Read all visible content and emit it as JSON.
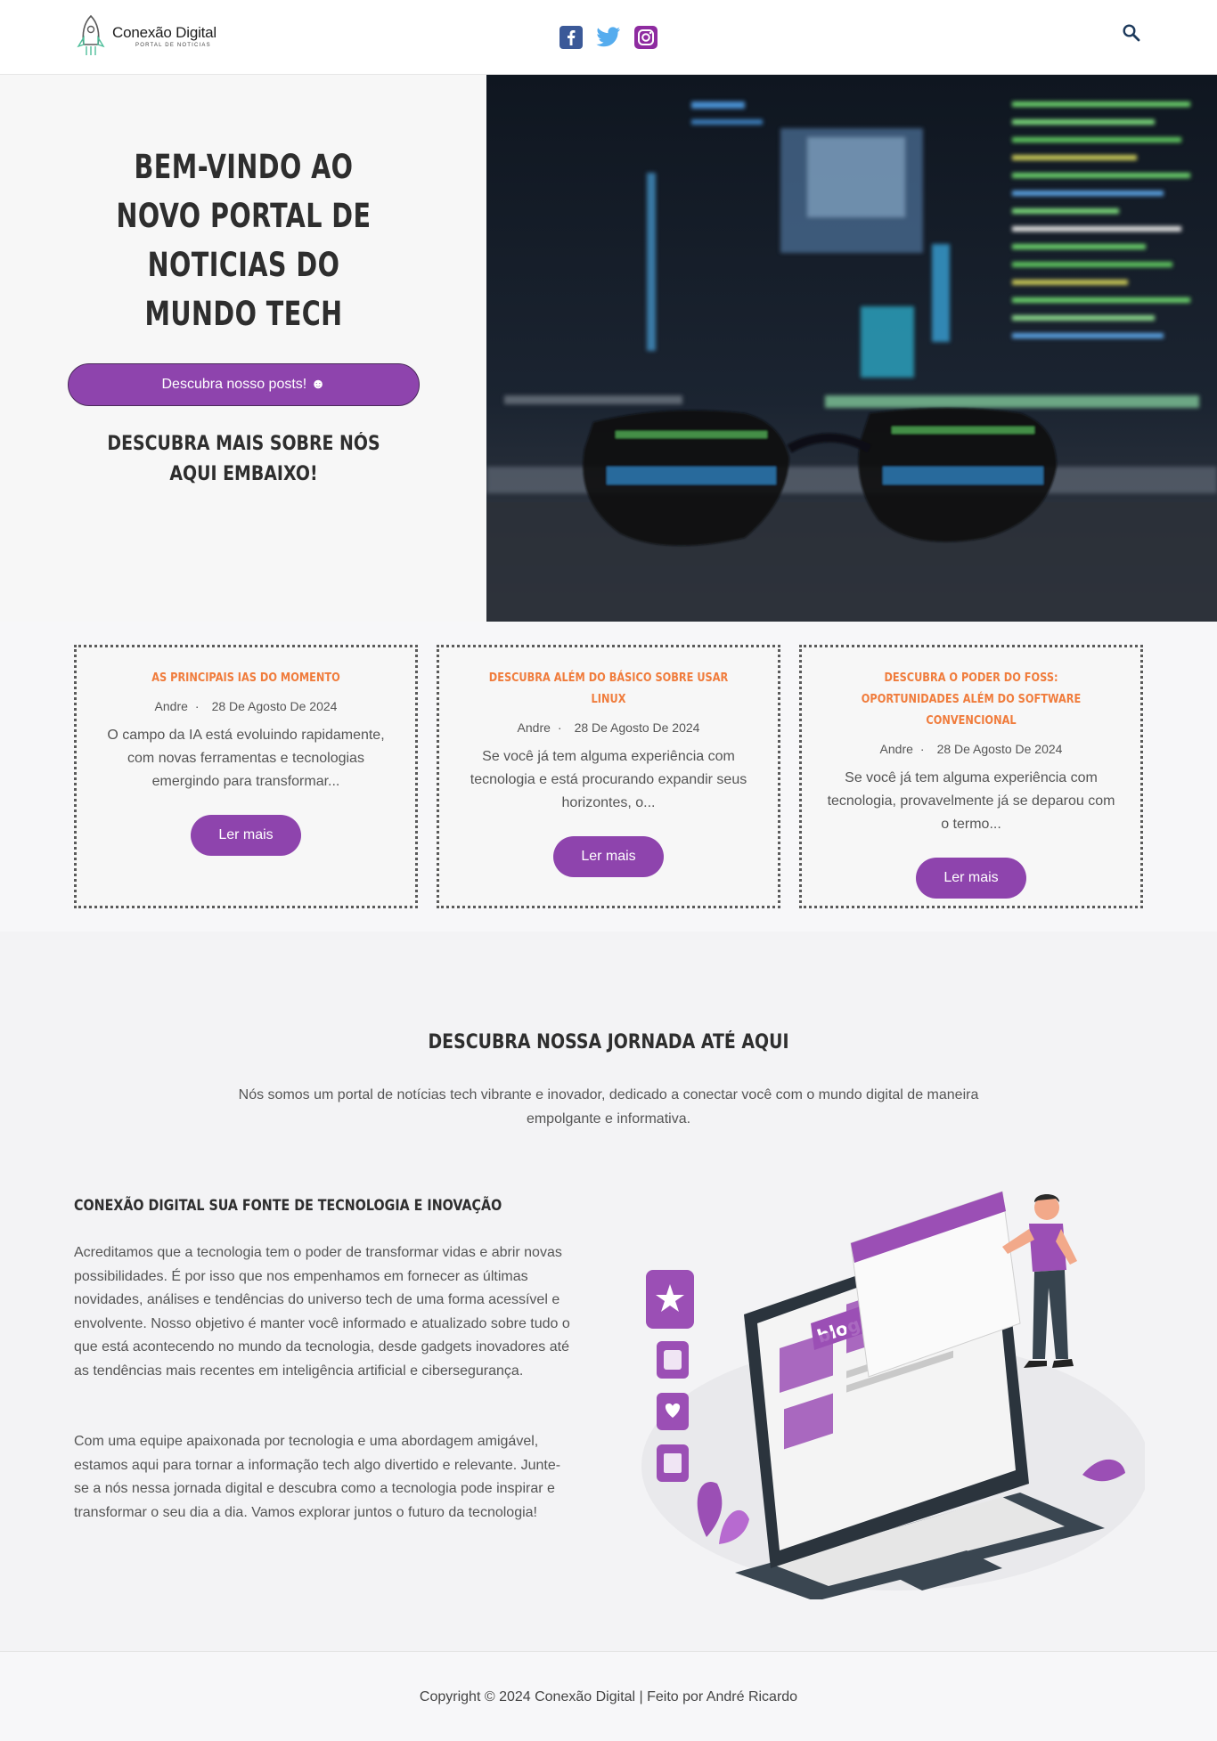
{
  "header": {
    "logo_name": "Conexão Digital",
    "logo_sub": "PORTAL DE NOTICIAS",
    "socials": [
      "facebook-icon",
      "twitter-icon",
      "instagram-icon"
    ],
    "search_icon": "search-icon"
  },
  "hero": {
    "title": "Bem-vindo ao novo portal de noticias do mundo tech",
    "button_label": "Descubra nosso posts! ☻",
    "subtitle": "Descubra mais sobre nós aqui embaixo!"
  },
  "posts": [
    {
      "title": "As principais IAs do momento",
      "author": "Andre",
      "date": "28 De Agosto De 2024",
      "excerpt": "O campo da IA está evoluindo rapidamente, com novas ferramentas e tecnologias emergindo para transformar...",
      "button": "Ler mais"
    },
    {
      "title": "Descubra Além do Básico sobre usar Linux",
      "author": "Andre",
      "date": "28 De Agosto De 2024",
      "excerpt": "Se você já tem alguma experiência com tecnologia e está procurando expandir seus horizontes, o...",
      "button": "Ler mais"
    },
    {
      "title": "Descubra o Poder do FOSS: Oportunidades Além do Software Convencional",
      "author": "Andre",
      "date": "28 De Agosto De 2024",
      "excerpt": "Se você já tem alguma experiência com tecnologia, provavelmente já se deparou com o termo...",
      "button": "Ler mais"
    }
  ],
  "about": {
    "title": "Descubra nossa jornada até aqui",
    "lead": "Nós somos um portal de notícias tech vibrante e inovador, dedicado a conectar você com o mundo digital de maneira empolgante e informativa.",
    "heading": "Conexão Digital sua fonte de tecnologia e inovação",
    "para1": "Acreditamos que a tecnologia tem o poder de transformar vidas e abrir novas possibilidades. É por isso que nos empenhamos em fornecer as últimas novidades, análises e tendências do universo tech de uma forma acessível e envolvente. Nosso objetivo é manter você informado e atualizado sobre tudo o que está acontecendo no mundo da tecnologia, desde gadgets inovadores até as tendências mais recentes em inteligência artificial e cibersegurança.",
    "para2": "Com uma equipe apaixonada por tecnologia e uma abordagem amigável, estamos aqui para tornar a informação tech algo divertido e relevante. Junte-se a nós nessa jornada digital e descubra como a tecnologia pode inspirar e transformar o seu dia a dia. Vamos explorar juntos o futuro da tecnologia!",
    "illustration_label": "blog"
  },
  "footer": {
    "copyright": "Copyright © 2024 Conexão Digital | Feito por André Ricardo"
  },
  "colors": {
    "accent": "#8e44ad",
    "post_title": "#f07c3c",
    "dark_text": "#2e2e2e"
  }
}
